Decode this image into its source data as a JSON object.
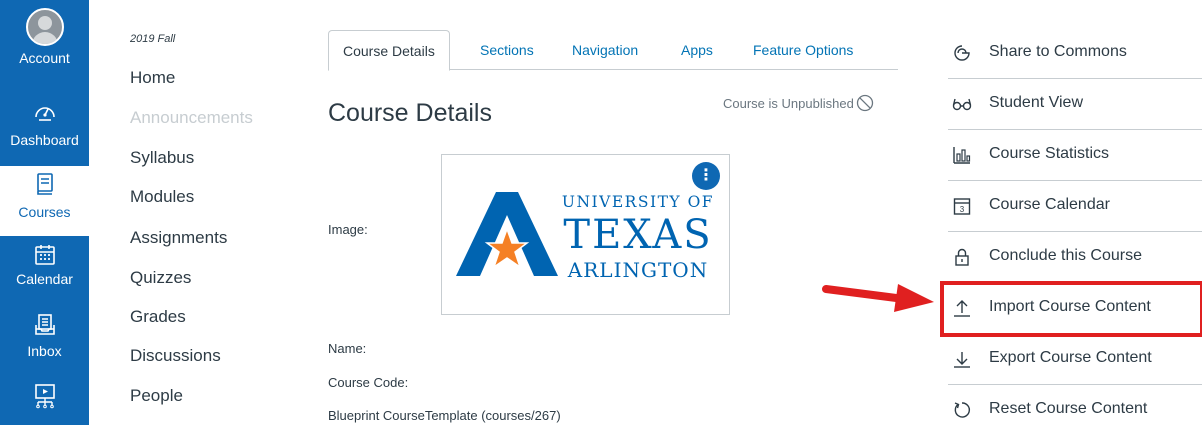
{
  "global_nav": {
    "items": [
      {
        "label": "Account",
        "icon": "avatar"
      },
      {
        "label": "Dashboard",
        "icon": "dashboard-gauge-icon"
      },
      {
        "label": "Courses",
        "icon": "book-icon",
        "active": true
      },
      {
        "label": "Calendar",
        "icon": "calendar-icon"
      },
      {
        "label": "Inbox",
        "icon": "inbox-icon"
      },
      {
        "label": "",
        "icon": "commons-monitor-icon"
      }
    ],
    "bg_color": "#0f68b3"
  },
  "course_nav": {
    "term": "2019 Fall",
    "items": [
      {
        "label": "Home",
        "disabled": false
      },
      {
        "label": "Announcements",
        "disabled": true
      },
      {
        "label": "Syllabus",
        "disabled": false
      },
      {
        "label": "Modules",
        "disabled": false
      },
      {
        "label": "Assignments",
        "disabled": false
      },
      {
        "label": "Quizzes",
        "disabled": false
      },
      {
        "label": "Grades",
        "disabled": false
      },
      {
        "label": "Discussions",
        "disabled": false
      },
      {
        "label": "People",
        "disabled": false
      }
    ]
  },
  "tabs": [
    {
      "label": "Course Details",
      "active": true
    },
    {
      "label": "Sections",
      "active": false
    },
    {
      "label": "Navigation",
      "active": false
    },
    {
      "label": "Apps",
      "active": false
    },
    {
      "label": "Feature Options",
      "active": false
    }
  ],
  "main": {
    "title": "Course Details",
    "publish_status": "Course is Unpublished",
    "image_label": "Image:",
    "name_label": "Name:",
    "code_label": "Course Code:",
    "blueprint_text": "Blueprint CourseTemplate (courses/267)",
    "logo": {
      "line1": "UNIVERSITY OF",
      "line2": "TEXAS",
      "line3": "ARLINGTON",
      "blue": "#0064b1",
      "orange": "#f58025"
    }
  },
  "right_sidebar": {
    "items": [
      {
        "label": "Share to Commons",
        "icon": "share-icon"
      },
      {
        "label": "Student View",
        "icon": "glasses-icon"
      },
      {
        "label": "Course Statistics",
        "icon": "statistics-icon"
      },
      {
        "label": "Course Calendar",
        "icon": "calendar-icon"
      },
      {
        "label": "Conclude this Course",
        "icon": "lock-icon"
      },
      {
        "label": "Import Course Content",
        "icon": "upload-icon",
        "highlighted": true
      },
      {
        "label": "Export Course Content",
        "icon": "download-icon"
      },
      {
        "label": "Reset Course Content",
        "icon": "reset-icon"
      }
    ],
    "highlight_color": "#e02020"
  }
}
